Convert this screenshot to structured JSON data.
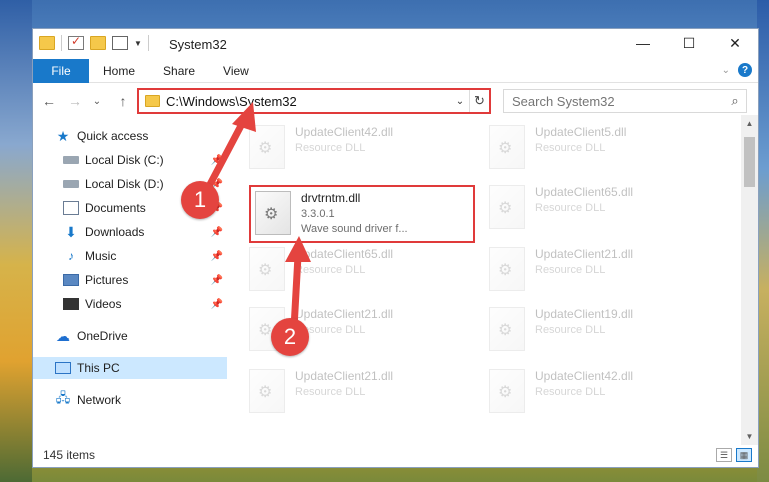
{
  "window": {
    "title": "System32",
    "controls": {
      "minimize": "—",
      "maximize": "☐",
      "close": "✕"
    }
  },
  "ribbon": {
    "tabs": [
      {
        "label": "File"
      },
      {
        "label": "Home"
      },
      {
        "label": "Share"
      },
      {
        "label": "View"
      }
    ]
  },
  "navigation": {
    "back": "←",
    "forward": "→",
    "recent": "⌄",
    "up": "↑",
    "address": "C:\\Windows\\System32",
    "refresh": "↻",
    "search_placeholder": "Search System32",
    "search_icon": "⌕"
  },
  "sidebar": {
    "items": [
      {
        "label": "Quick access",
        "icon": "star-icon",
        "pinned": false
      },
      {
        "label": "Local Disk (C:)",
        "icon": "disk-icon",
        "pinned": true
      },
      {
        "label": "Local Disk (D:)",
        "icon": "disk-icon",
        "pinned": true
      },
      {
        "label": "Documents",
        "icon": "documents-icon",
        "pinned": true
      },
      {
        "label": "Downloads",
        "icon": "download-icon",
        "pinned": true
      },
      {
        "label": "Music",
        "icon": "music-icon",
        "pinned": true
      },
      {
        "label": "Pictures",
        "icon": "pictures-icon",
        "pinned": true
      },
      {
        "label": "Videos",
        "icon": "videos-icon",
        "pinned": true
      },
      {
        "label": "OneDrive",
        "icon": "cloud-icon",
        "pinned": false
      },
      {
        "label": "This PC",
        "icon": "pc-icon",
        "pinned": false,
        "selected": true
      },
      {
        "label": "Network",
        "icon": "network-icon",
        "pinned": false
      }
    ]
  },
  "files": [
    {
      "name": "UpdateClient42.dll",
      "desc": "Resource DLL",
      "faded": true
    },
    {
      "name": "UpdateClient5.dll",
      "desc": "Resource DLL",
      "faded": true
    },
    {
      "name": "drvtrntm.dll",
      "version": "3.3.0.1",
      "desc": "Wave sound driver f...",
      "faded": false
    },
    {
      "name": "UpdateClient65.dll",
      "desc": "Resource DLL",
      "faded": true
    },
    {
      "name": "UpdateClient65.dll",
      "desc": "Resource DLL",
      "faded": true
    },
    {
      "name": "UpdateClient21.dll",
      "desc": "Resource DLL",
      "faded": true
    },
    {
      "name": "UpdateClient21.dll",
      "desc": "Resource DLL",
      "faded": true
    },
    {
      "name": "UpdateClient19.dll",
      "desc": "Resource DLL",
      "faded": true
    },
    {
      "name": "UpdateClient21.dll",
      "desc": "Resource DLL",
      "faded": true
    },
    {
      "name": "UpdateClient42.dll",
      "desc": "Resource DLL",
      "faded": true
    }
  ],
  "status": {
    "items_count": "145 items"
  },
  "callouts": [
    {
      "number": "1"
    },
    {
      "number": "2"
    }
  ],
  "colors": {
    "accent": "#1979ca",
    "highlight_red": "#e03a3a"
  }
}
